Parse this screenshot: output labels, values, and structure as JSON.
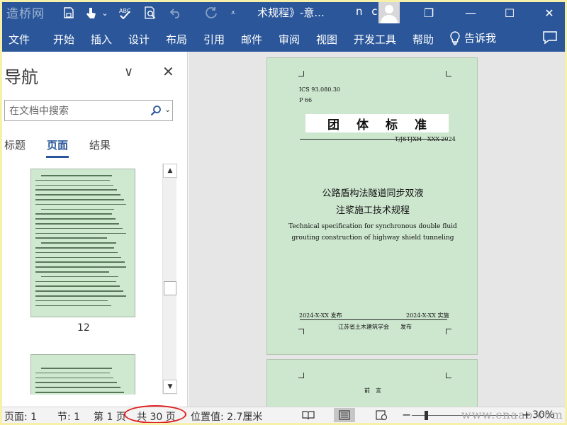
{
  "titlebar": {
    "watermark": "造桥网",
    "doc_title": "术规程》-意...",
    "user_name": "n c",
    "restore_glyph": "❐",
    "minimize_glyph": "—",
    "maximize_glyph": "☐",
    "close_glyph": "✕",
    "quick_access": [
      "save-icon",
      "touch-mode-icon",
      "customize-arrow-icon",
      "spelling-check-icon",
      "print-preview-icon",
      "undo-icon",
      "redo-icon",
      "more-commands-icon"
    ]
  },
  "ribbon": {
    "tabs": [
      "文件",
      "开始",
      "插入",
      "设计",
      "布局",
      "引用",
      "邮件",
      "审阅",
      "视图",
      "开发工具",
      "帮助"
    ],
    "tell_me": "告诉我"
  },
  "nav": {
    "title": "导航",
    "collapse_glyph": "∨",
    "close_glyph": "✕",
    "search_placeholder": "在文档中搜索",
    "tabs": [
      "标题",
      "页面",
      "结果"
    ],
    "active_tab": "页面",
    "thumb_label": "12"
  },
  "document": {
    "ics": "ICS 93.080.30",
    "p_code": "P 66",
    "standard_title": "团体标准",
    "std_number": "T/JSTJXH　XXX-2024",
    "title_cn_line1": "公路盾构法隧道同步双液",
    "title_cn_line2": "注浆施工技术规程",
    "title_en_line1": "Technical specification for synchronous double fluid",
    "title_en_line2": "grouting construction of highway shield tunneling",
    "publish_date": "2024-X-XX  发布",
    "implement_date": "2024-X-XX  实施",
    "publisher": "江苏省土木建筑学会",
    "publisher_action": "发布",
    "page2_heading": "前　言"
  },
  "status": {
    "page": "页面: 1",
    "section": "节: 1",
    "page_of": "第 1 页",
    "total_pages": "共 30 页",
    "position": "位置值: 2.7厘米",
    "zoom": "30%",
    "zoom_minus": "−",
    "zoom_plus": "+",
    "watermark": "www.cnaao.com",
    "highlight_color": "#e02020"
  },
  "colors": {
    "ribbon": "#2b579a",
    "page_green": "#cde7cf",
    "border_yellow": "#f6f0a8"
  }
}
